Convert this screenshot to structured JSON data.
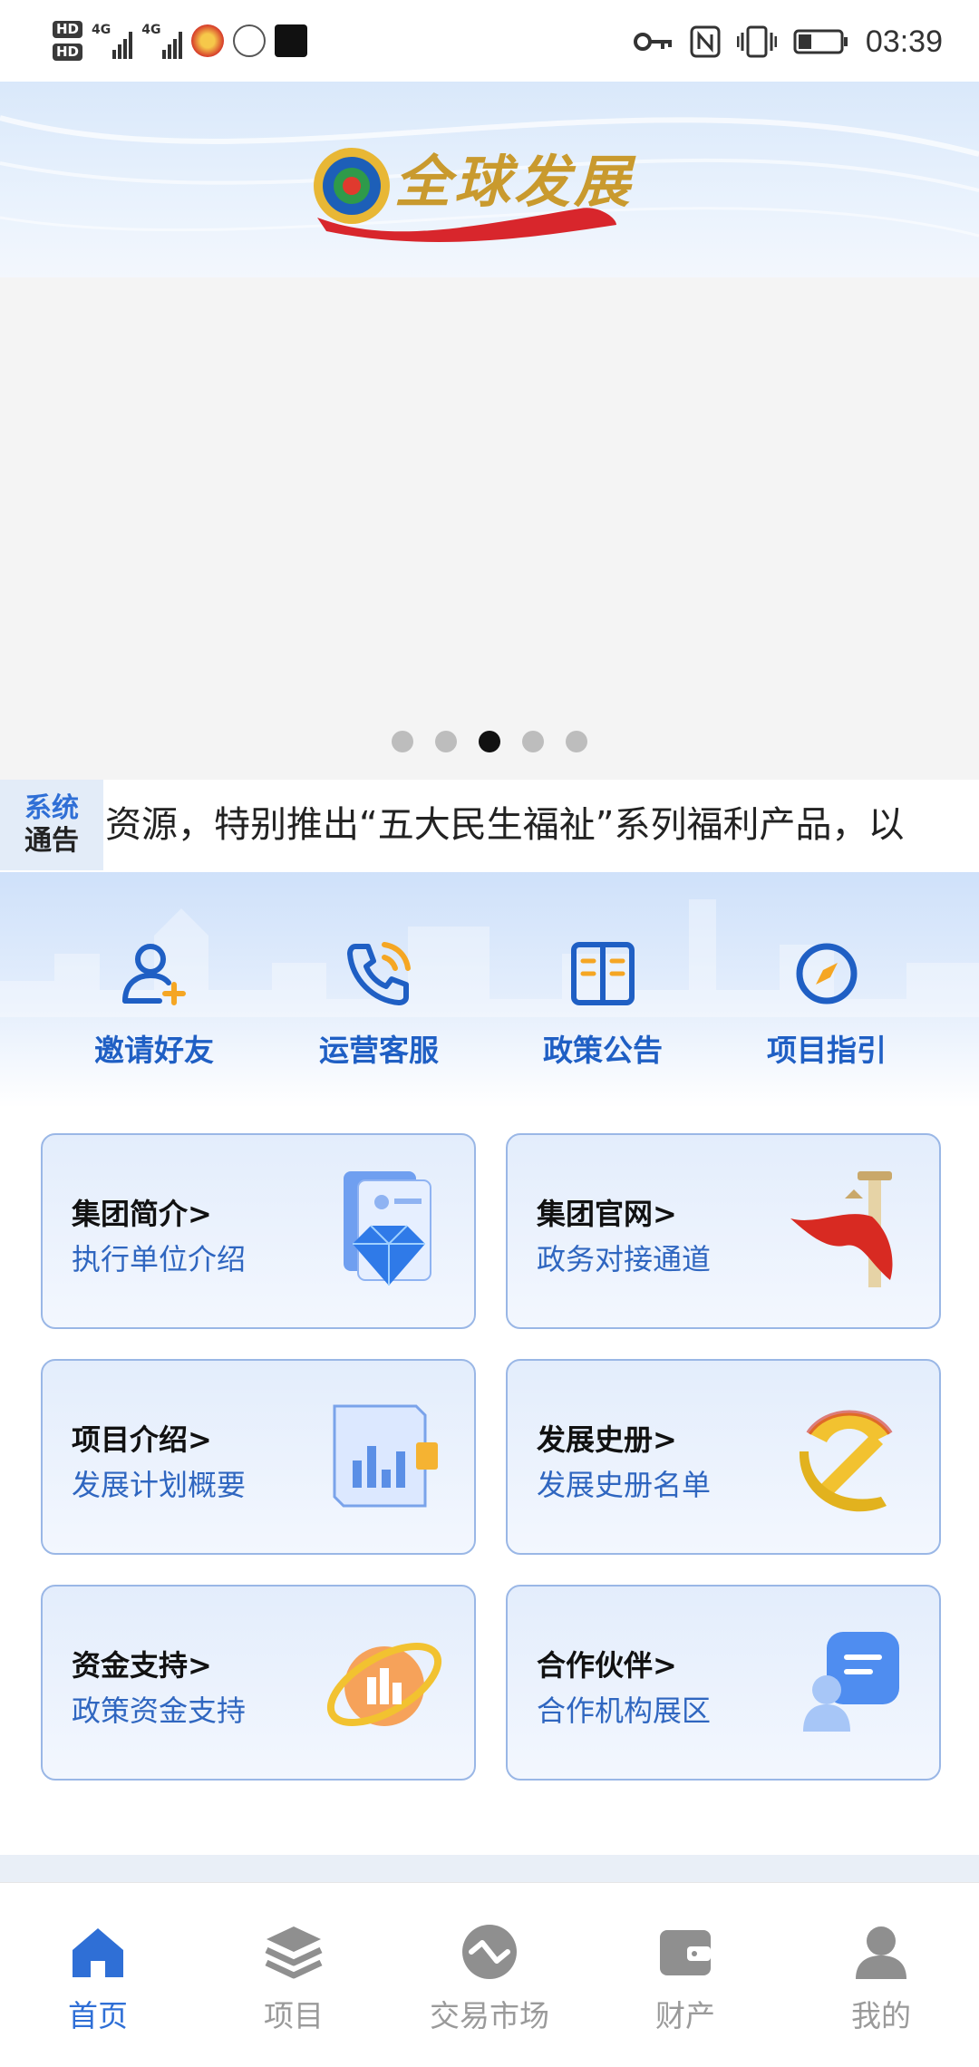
{
  "status_bar": {
    "time": "03:39",
    "network_1": "4G",
    "network_2": "4G",
    "hd_1": "HD",
    "hd_2": "HD"
  },
  "carousel": {
    "dot_count": 5,
    "active_index": 2
  },
  "notice": {
    "tag_line1": "系统",
    "tag_line2": "通告",
    "text": "资源，特别推出“五大民生福祉”系列福利产品，以"
  },
  "quick_actions": [
    {
      "label": "邀请好友",
      "icon": "add-user-icon"
    },
    {
      "label": "运营客服",
      "icon": "phone-icon"
    },
    {
      "label": "政策公告",
      "icon": "book-icon"
    },
    {
      "label": "项目指引",
      "icon": "compass-icon"
    }
  ],
  "cards": [
    {
      "title": "集团简介>",
      "subtitle": "执行单位介绍",
      "icon": "diamond-document-icon"
    },
    {
      "title": "集团官网>",
      "subtitle": "政务对接通道",
      "icon": "pillar-flag-icon"
    },
    {
      "title": "项目介绍>",
      "subtitle": "发展计划概要",
      "icon": "report-chart-icon"
    },
    {
      "title": "发展史册>",
      "subtitle": "发展史册名单",
      "icon": "emblem-icon"
    },
    {
      "title": "资金支持>",
      "subtitle": "政策资金支持",
      "icon": "orbit-chart-icon"
    },
    {
      "title": "合作伙伴>",
      "subtitle": "合作机构展区",
      "icon": "partner-chat-icon"
    }
  ],
  "tabs": [
    {
      "label": "首页",
      "icon": "home-icon",
      "active": true
    },
    {
      "label": "项目",
      "icon": "layers-icon",
      "active": false
    },
    {
      "label": "交易市场",
      "icon": "market-icon",
      "active": false
    },
    {
      "label": "财产",
      "icon": "wallet-icon",
      "active": false
    },
    {
      "label": "我的",
      "icon": "profile-icon",
      "active": false
    }
  ],
  "colors": {
    "primary": "#2f6fd6",
    "inactive": "#9a9a9a",
    "card_border": "#9ab7e6"
  }
}
